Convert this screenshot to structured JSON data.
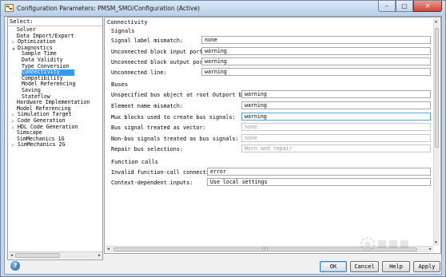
{
  "window": {
    "title": "Configuration Parameters: PMSM_SMO/Configuration (Active)",
    "controls": {
      "minimize": "–",
      "maximize": "□",
      "close": "✕"
    }
  },
  "tree": {
    "label": "Select:",
    "items": [
      {
        "label": "Solver",
        "expander": ""
      },
      {
        "label": "Data Import/Export",
        "expander": ""
      },
      {
        "label": "Optimization",
        "expander": "▷"
      },
      {
        "label": "Diagnostics",
        "expander": "◢"
      },
      {
        "label": "Sample Time",
        "expander": ""
      },
      {
        "label": "Data Validity",
        "expander": ""
      },
      {
        "label": "Type Conversion",
        "expander": ""
      },
      {
        "label": "Connectivity",
        "expander": ""
      },
      {
        "label": "Compatibility",
        "expander": ""
      },
      {
        "label": "Model Referencing",
        "expander": ""
      },
      {
        "label": "Saving",
        "expander": ""
      },
      {
        "label": "Stateflow",
        "expander": ""
      },
      {
        "label": "Hardware Implementation",
        "expander": ""
      },
      {
        "label": "Model Referencing",
        "expander": ""
      },
      {
        "label": "Simulation Target",
        "expander": "▷"
      },
      {
        "label": "Code Generation",
        "expander": "▷"
      },
      {
        "label": "HDL Code Generation",
        "expander": "▷"
      },
      {
        "label": "Simscape",
        "expander": ""
      },
      {
        "label": "SimMechanics 1G",
        "expander": ""
      },
      {
        "label": "SimMechanics 2G",
        "expander": "▷"
      }
    ],
    "selected_index": 7
  },
  "panel": {
    "title": "Connectivity",
    "signals": {
      "title": "Signals",
      "rows": [
        {
          "label": "Signal label mismatch:",
          "value": "none",
          "state": "normal"
        },
        {
          "label": "Unconnected block input ports:",
          "value": "warning",
          "state": "normal"
        },
        {
          "label": "Unconnected block output ports:",
          "value": "warning",
          "state": "normal"
        },
        {
          "label": "Unconnected line:",
          "value": "warning",
          "state": "normal"
        }
      ]
    },
    "buses": {
      "title": "Buses",
      "rows": [
        {
          "label": "Unspecified bus object at root Outport block:",
          "value": "warning",
          "state": "normal"
        },
        {
          "label": "Element name mismatch:",
          "value": "warning",
          "state": "normal"
        },
        {
          "label": "Mux blocks used to create bus signals:",
          "value": "warning",
          "state": "focused"
        },
        {
          "label": "Bus signal treated as vector:",
          "value": "none",
          "state": "disabled"
        },
        {
          "label": "Non-bus signals treated as bus signals:",
          "value": "none",
          "state": "disabled"
        },
        {
          "label": "Repair bus selections:",
          "value": "Warn and repair",
          "state": "disabled"
        }
      ]
    },
    "function_calls": {
      "title": "Function calls",
      "rows": [
        {
          "label": "Invalid function-call connection:",
          "value": "error",
          "state": "normal"
        },
        {
          "label": "Context-dependent inputs:",
          "value": "Use local settings",
          "state": "normal"
        }
      ]
    }
  },
  "buttons": {
    "help_icon": "?",
    "ok": "OK",
    "cancel": "Cancel",
    "help": "Help",
    "apply": "Apply"
  },
  "colors": {
    "selection": "#3399ff",
    "focus_border": "#56a8e0",
    "disabled_text": "#9a9a9a"
  }
}
